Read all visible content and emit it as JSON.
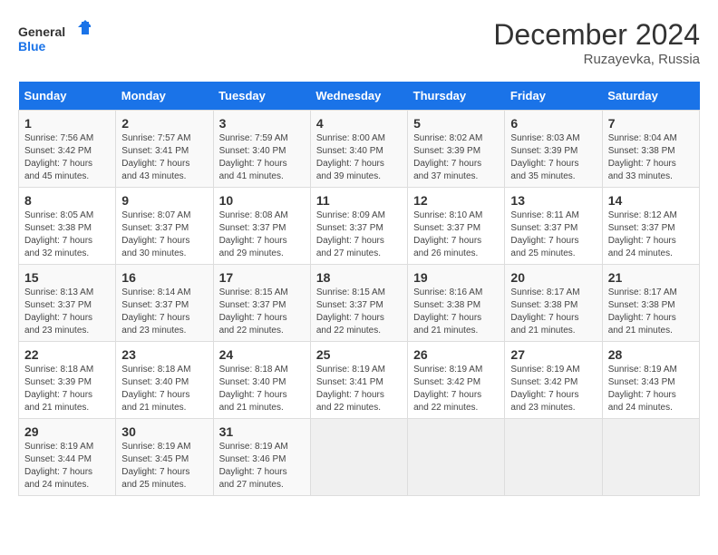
{
  "header": {
    "logo_line1": "General",
    "logo_line2": "Blue",
    "month_title": "December 2024",
    "subtitle": "Ruzayevka, Russia"
  },
  "weekdays": [
    "Sunday",
    "Monday",
    "Tuesday",
    "Wednesday",
    "Thursday",
    "Friday",
    "Saturday"
  ],
  "weeks": [
    [
      {
        "day": "1",
        "info": "Sunrise: 7:56 AM\nSunset: 3:42 PM\nDaylight: 7 hours and 45 minutes."
      },
      {
        "day": "2",
        "info": "Sunrise: 7:57 AM\nSunset: 3:41 PM\nDaylight: 7 hours and 43 minutes."
      },
      {
        "day": "3",
        "info": "Sunrise: 7:59 AM\nSunset: 3:40 PM\nDaylight: 7 hours and 41 minutes."
      },
      {
        "day": "4",
        "info": "Sunrise: 8:00 AM\nSunset: 3:40 PM\nDaylight: 7 hours and 39 minutes."
      },
      {
        "day": "5",
        "info": "Sunrise: 8:02 AM\nSunset: 3:39 PM\nDaylight: 7 hours and 37 minutes."
      },
      {
        "day": "6",
        "info": "Sunrise: 8:03 AM\nSunset: 3:39 PM\nDaylight: 7 hours and 35 minutes."
      },
      {
        "day": "7",
        "info": "Sunrise: 8:04 AM\nSunset: 3:38 PM\nDaylight: 7 hours and 33 minutes."
      }
    ],
    [
      {
        "day": "8",
        "info": "Sunrise: 8:05 AM\nSunset: 3:38 PM\nDaylight: 7 hours and 32 minutes."
      },
      {
        "day": "9",
        "info": "Sunrise: 8:07 AM\nSunset: 3:37 PM\nDaylight: 7 hours and 30 minutes."
      },
      {
        "day": "10",
        "info": "Sunrise: 8:08 AM\nSunset: 3:37 PM\nDaylight: 7 hours and 29 minutes."
      },
      {
        "day": "11",
        "info": "Sunrise: 8:09 AM\nSunset: 3:37 PM\nDaylight: 7 hours and 27 minutes."
      },
      {
        "day": "12",
        "info": "Sunrise: 8:10 AM\nSunset: 3:37 PM\nDaylight: 7 hours and 26 minutes."
      },
      {
        "day": "13",
        "info": "Sunrise: 8:11 AM\nSunset: 3:37 PM\nDaylight: 7 hours and 25 minutes."
      },
      {
        "day": "14",
        "info": "Sunrise: 8:12 AM\nSunset: 3:37 PM\nDaylight: 7 hours and 24 minutes."
      }
    ],
    [
      {
        "day": "15",
        "info": "Sunrise: 8:13 AM\nSunset: 3:37 PM\nDaylight: 7 hours and 23 minutes."
      },
      {
        "day": "16",
        "info": "Sunrise: 8:14 AM\nSunset: 3:37 PM\nDaylight: 7 hours and 23 minutes."
      },
      {
        "day": "17",
        "info": "Sunrise: 8:15 AM\nSunset: 3:37 PM\nDaylight: 7 hours and 22 minutes."
      },
      {
        "day": "18",
        "info": "Sunrise: 8:15 AM\nSunset: 3:37 PM\nDaylight: 7 hours and 22 minutes."
      },
      {
        "day": "19",
        "info": "Sunrise: 8:16 AM\nSunset: 3:38 PM\nDaylight: 7 hours and 21 minutes."
      },
      {
        "day": "20",
        "info": "Sunrise: 8:17 AM\nSunset: 3:38 PM\nDaylight: 7 hours and 21 minutes."
      },
      {
        "day": "21",
        "info": "Sunrise: 8:17 AM\nSunset: 3:38 PM\nDaylight: 7 hours and 21 minutes."
      }
    ],
    [
      {
        "day": "22",
        "info": "Sunrise: 8:18 AM\nSunset: 3:39 PM\nDaylight: 7 hours and 21 minutes."
      },
      {
        "day": "23",
        "info": "Sunrise: 8:18 AM\nSunset: 3:40 PM\nDaylight: 7 hours and 21 minutes."
      },
      {
        "day": "24",
        "info": "Sunrise: 8:18 AM\nSunset: 3:40 PM\nDaylight: 7 hours and 21 minutes."
      },
      {
        "day": "25",
        "info": "Sunrise: 8:19 AM\nSunset: 3:41 PM\nDaylight: 7 hours and 22 minutes."
      },
      {
        "day": "26",
        "info": "Sunrise: 8:19 AM\nSunset: 3:42 PM\nDaylight: 7 hours and 22 minutes."
      },
      {
        "day": "27",
        "info": "Sunrise: 8:19 AM\nSunset: 3:42 PM\nDaylight: 7 hours and 23 minutes."
      },
      {
        "day": "28",
        "info": "Sunrise: 8:19 AM\nSunset: 3:43 PM\nDaylight: 7 hours and 24 minutes."
      }
    ],
    [
      {
        "day": "29",
        "info": "Sunrise: 8:19 AM\nSunset: 3:44 PM\nDaylight: 7 hours and 24 minutes."
      },
      {
        "day": "30",
        "info": "Sunrise: 8:19 AM\nSunset: 3:45 PM\nDaylight: 7 hours and 25 minutes."
      },
      {
        "day": "31",
        "info": "Sunrise: 8:19 AM\nSunset: 3:46 PM\nDaylight: 7 hours and 27 minutes."
      },
      null,
      null,
      null,
      null
    ]
  ]
}
